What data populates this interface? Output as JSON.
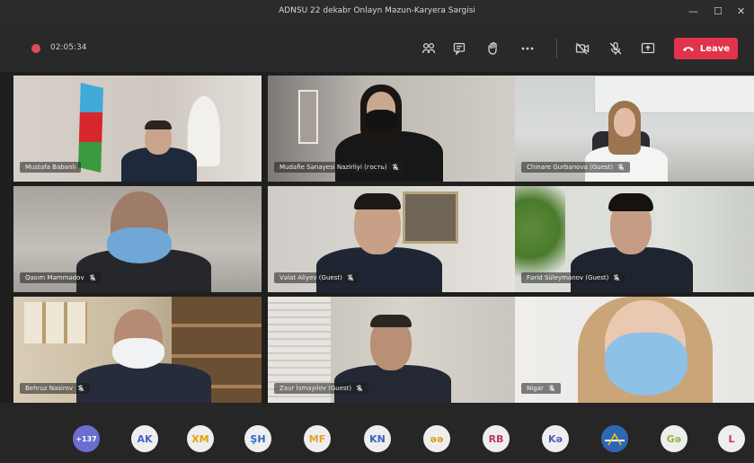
{
  "window": {
    "title": "ADNSU 22 dekabr Onlayn Məzun-Karyera Sərgisi"
  },
  "toolbar": {
    "timer": "02:05:34",
    "leave_label": "Leave"
  },
  "participants": [
    {
      "name": "Mustafa Babanlı",
      "mic": ""
    },
    {
      "name": "Mudafie Sənayesi Nazirliyi (гость)",
      "mic": "muted"
    },
    {
      "name": "Chinare Gurbanova (Guest)",
      "mic": "muted"
    },
    {
      "name": "Qasım Məmmədov",
      "mic": "muted"
    },
    {
      "name": "Vəlat Aliyev (Guest)",
      "mic": "muted"
    },
    {
      "name": "Fərid Süleymanov (Guest)",
      "mic": "muted"
    },
    {
      "name": "Behruz Nasirov",
      "mic": "muted"
    },
    {
      "name": "Zaur İsmayılov (Guest)",
      "mic": "muted"
    },
    {
      "name": "Nigar",
      "mic": "muted"
    }
  ],
  "attendees": {
    "overflow_count": "+137",
    "avatars": [
      {
        "initials": "AK",
        "color": "#4c62c4"
      },
      {
        "initials": "XM",
        "color": "#e0a400"
      },
      {
        "initials": "ŞH",
        "color": "#2f66c6"
      },
      {
        "initials": "MF",
        "color": "#e3a223"
      },
      {
        "initials": "KN",
        "color": "#3a5fc0"
      },
      {
        "initials": "əə",
        "color": "#e39a12"
      },
      {
        "initials": "RB",
        "color": "#c0395a"
      },
      {
        "initials": "Kə",
        "color": "#4a5fbf"
      },
      {
        "initials": "",
        "color": "#2e67b3",
        "type": "logo"
      },
      {
        "initials": "Gə",
        "color": "#8cb93d"
      },
      {
        "initials": "L",
        "color": "#d0305a"
      }
    ]
  },
  "colors": {
    "leave": "#e1334b",
    "recording": "#e04a5f",
    "overflow_badge": "#6b6ecf"
  },
  "icons": {
    "toolbar": [
      "participants-icon",
      "chat-icon",
      "raise-hand-icon",
      "more-icon",
      "camera-off-icon",
      "mic-off-icon",
      "share-screen-icon",
      "phone-hangup-icon"
    ],
    "label": "mic-off-icon"
  }
}
